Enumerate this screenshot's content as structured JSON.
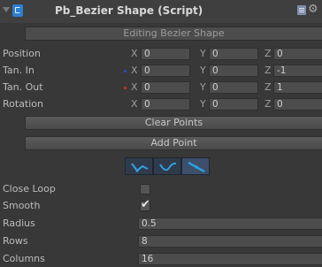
{
  "header": {
    "title": "Pb_Bezier Shape (Script)"
  },
  "section": {
    "label": "Editing Bezier Shape"
  },
  "rows": [
    {
      "label": "Position",
      "marker": "",
      "x": "0",
      "y": "0",
      "z": "0"
    },
    {
      "label": "Tan. In",
      "marker": "#2a4bd8",
      "x": "0",
      "y": "0",
      "z": "-1"
    },
    {
      "label": "Tan. Out",
      "marker": "#c83030",
      "x": "0",
      "y": "0",
      "z": "1"
    },
    {
      "label": "Rotation",
      "marker": "",
      "x": "0",
      "y": "0",
      "z": "0"
    }
  ],
  "axis_labels": {
    "x": "X",
    "y": "Y",
    "z": "Z"
  },
  "buttons": {
    "clear_points": "Clear Points",
    "add_point": "Add Point"
  },
  "tangent_modes": {
    "icons": [
      "tangent-broken-icon",
      "tangent-aligned-icon",
      "tangent-free-icon"
    ],
    "selected": 2,
    "accent": "#2ea3e0"
  },
  "settings": {
    "close_loop": {
      "label": "Close Loop",
      "checked": false
    },
    "smooth": {
      "label": "Smooth",
      "checked": true
    },
    "radius": {
      "label": "Radius",
      "value": "0.5"
    },
    "rows": {
      "label": "Rows",
      "value": "8"
    },
    "columns": {
      "label": "Columns",
      "value": "16"
    }
  }
}
